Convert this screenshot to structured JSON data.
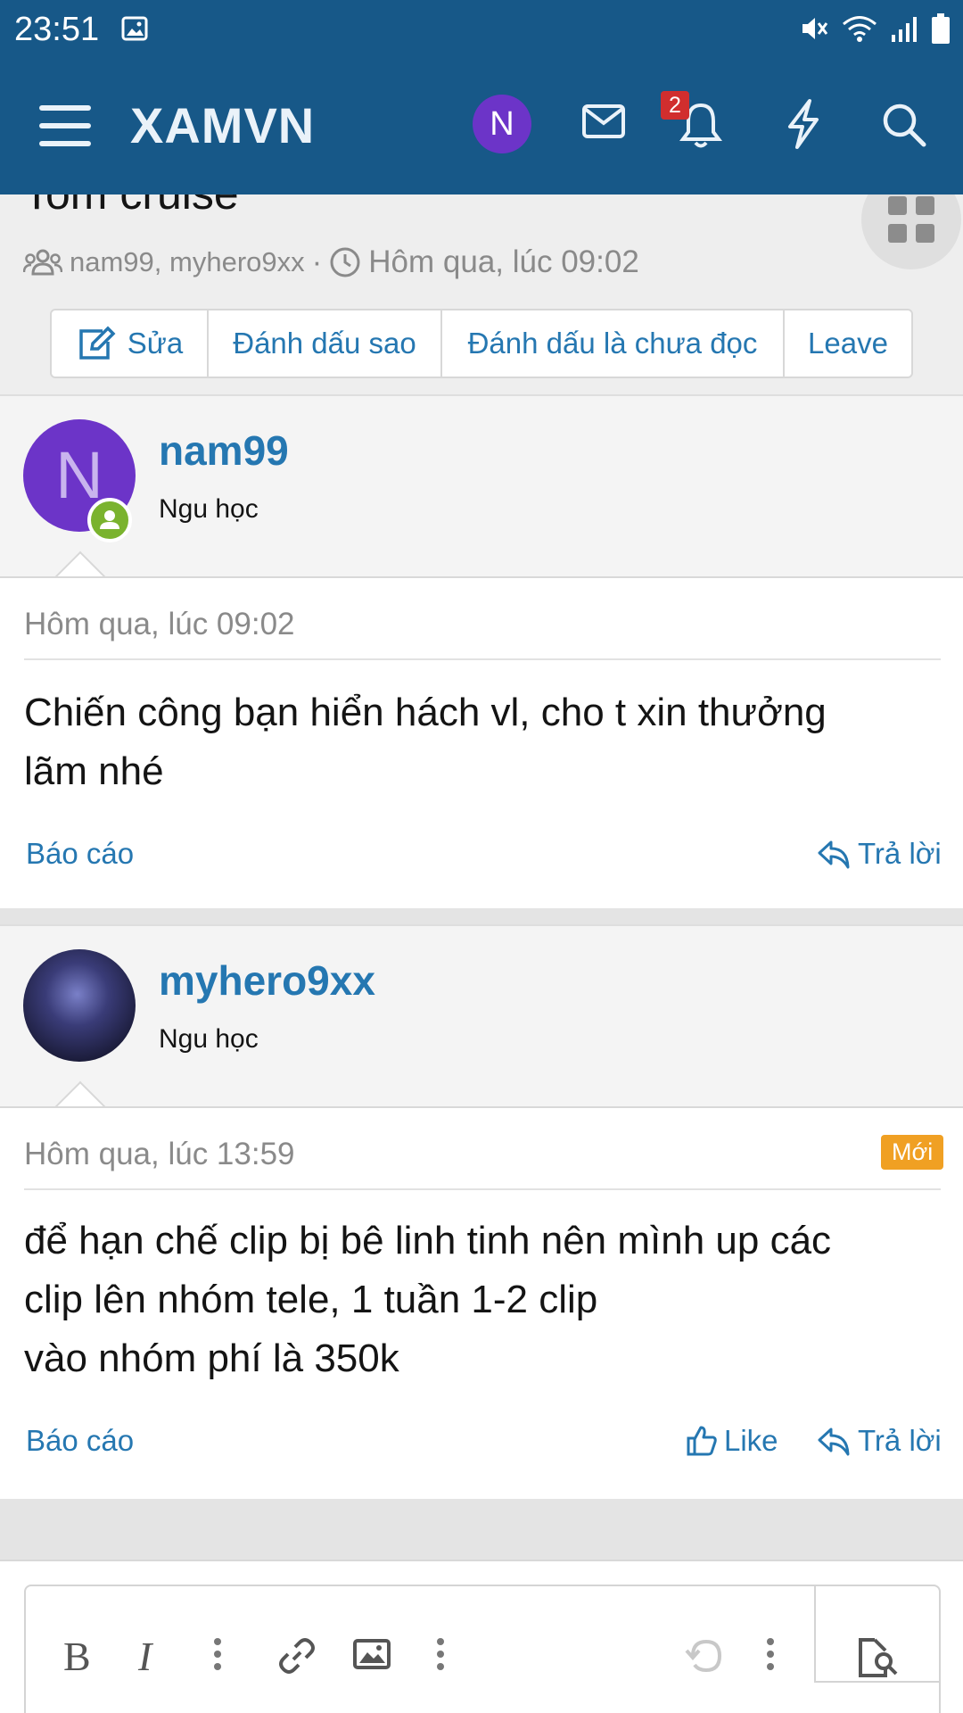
{
  "status_bar": {
    "time": "23:51"
  },
  "app_bar": {
    "logo": "XAMVN",
    "avatar_letter": "N",
    "notification_count": "2"
  },
  "thread": {
    "title": "Tom cruise",
    "participants": "nam99, myhero9xx",
    "separator": "·",
    "date": "Hôm qua, lúc 09:02",
    "buttons": {
      "edit": "Sửa",
      "star": "Đánh dấu sao",
      "unread": "Đánh dấu là chưa đọc",
      "leave": "Leave"
    }
  },
  "posts": [
    {
      "author": "nam99",
      "avatar_letter": "N",
      "user_title": "Ngu học",
      "date": "Hôm qua, lúc 09:02",
      "text": "Chiến công bạn hiển hách vl, cho t xin thưởng\nlãm nhé",
      "report": "Báo cáo",
      "reply": "Trả lời"
    },
    {
      "author": "myhero9xx",
      "user_title": "Ngu học",
      "date": "Hôm qua, lúc 13:59",
      "badge": "Mới",
      "text": "để hạn chế clip bị bê linh tinh nên mình up các\nclip lên nhóm tele, 1 tuần 1-2 clip\nvào nhóm phí là 350k",
      "report": "Báo cáo",
      "like": "Like",
      "reply": "Trả lời"
    }
  ],
  "colors": {
    "primary": "#175888",
    "link": "#2577b1",
    "avatar_purple": "#6c34c8",
    "online_green": "#7ab32e",
    "new_badge": "#f0a023",
    "notification_badge": "#d12e2e"
  }
}
